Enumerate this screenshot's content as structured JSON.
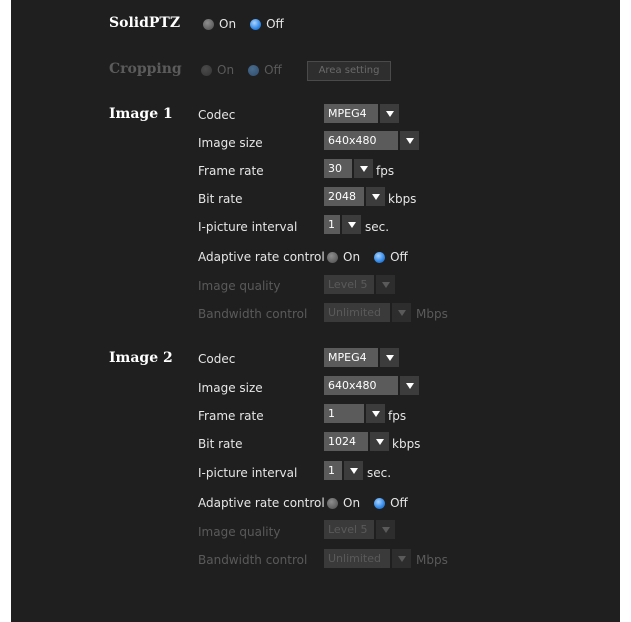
{
  "solid_ptz": {
    "label": "SolidPTZ",
    "options": [
      "On",
      "Off"
    ],
    "selected": "Off"
  },
  "cropping": {
    "label": "Cropping",
    "options": [
      "On",
      "Off"
    ],
    "selected": "Off",
    "area_button": "Area setting"
  },
  "image1": {
    "label": "Image 1",
    "codec": {
      "label": "Codec",
      "value": "MPEG4"
    },
    "image_size": {
      "label": "Image size",
      "value": "640x480"
    },
    "frame_rate": {
      "label": "Frame rate",
      "value": "30",
      "unit": "fps"
    },
    "bit_rate": {
      "label": "Bit rate",
      "value": "2048",
      "unit": "kbps"
    },
    "ipicture": {
      "label": "I-picture interval",
      "value": "1",
      "unit": "sec."
    },
    "adaptive": {
      "label": "Adaptive rate control",
      "options": [
        "On",
        "Off"
      ],
      "selected": "Off"
    },
    "image_quality": {
      "label": "Image quality",
      "value": "Level 5"
    },
    "bandwidth": {
      "label": "Bandwidth control",
      "value": "Unlimited",
      "unit": "Mbps"
    }
  },
  "image2": {
    "label": "Image 2",
    "codec": {
      "label": "Codec",
      "value": "MPEG4"
    },
    "image_size": {
      "label": "Image size",
      "value": "640x480"
    },
    "frame_rate": {
      "label": "Frame rate",
      "value": "1",
      "unit": "fps"
    },
    "bit_rate": {
      "label": "Bit rate",
      "value": "1024",
      "unit": "kbps"
    },
    "ipicture": {
      "label": "I-picture interval",
      "value": "1",
      "unit": "sec."
    },
    "adaptive": {
      "label": "Adaptive rate control",
      "options": [
        "On",
        "Off"
      ],
      "selected": "Off"
    },
    "image_quality": {
      "label": "Image quality",
      "value": "Level 5"
    },
    "bandwidth": {
      "label": "Bandwidth control",
      "value": "Unlimited",
      "unit": "Mbps"
    }
  },
  "colors": {
    "background": "#1f1f1f",
    "radio_selected": "#2f86e6",
    "disabled_text": "#5a5a5a"
  }
}
